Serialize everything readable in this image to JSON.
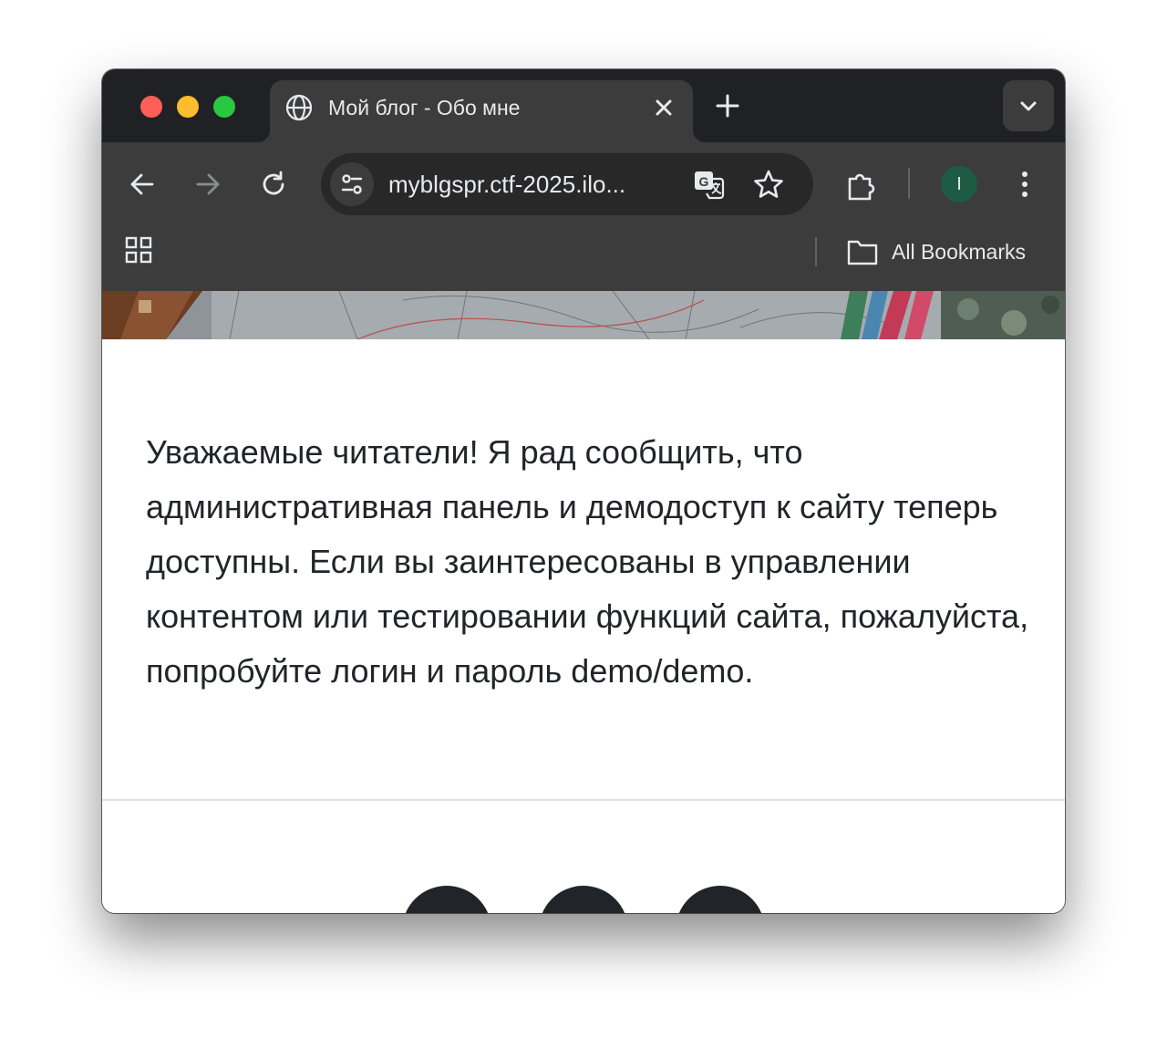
{
  "browser": {
    "tab": {
      "title": "Мой блог - Обо мне"
    },
    "address_bar": {
      "url": "myblgspr.ctf-2025.ilo..."
    },
    "profile": {
      "initial": "I"
    },
    "bookmarks_bar": {
      "all_bookmarks_label": "All Bookmarks"
    },
    "colors": {
      "frame": "#202124",
      "toolbar": "#3c3c3c",
      "omnibox": "#282828",
      "avatar": "#1e5b45"
    }
  },
  "page": {
    "article_text": "Уважаемые читатели! Я рад сообщить, что административная панель и демодоступ к сайту теперь доступны. Если вы заинтересованы в управлении контентом или тестировании функций сайта, пожалуйста, попробуйте логин и пароль demo/demo.",
    "text_color": "#212529",
    "social_icons": [
      "social-icon-1",
      "social-icon-2",
      "social-icon-3"
    ]
  }
}
